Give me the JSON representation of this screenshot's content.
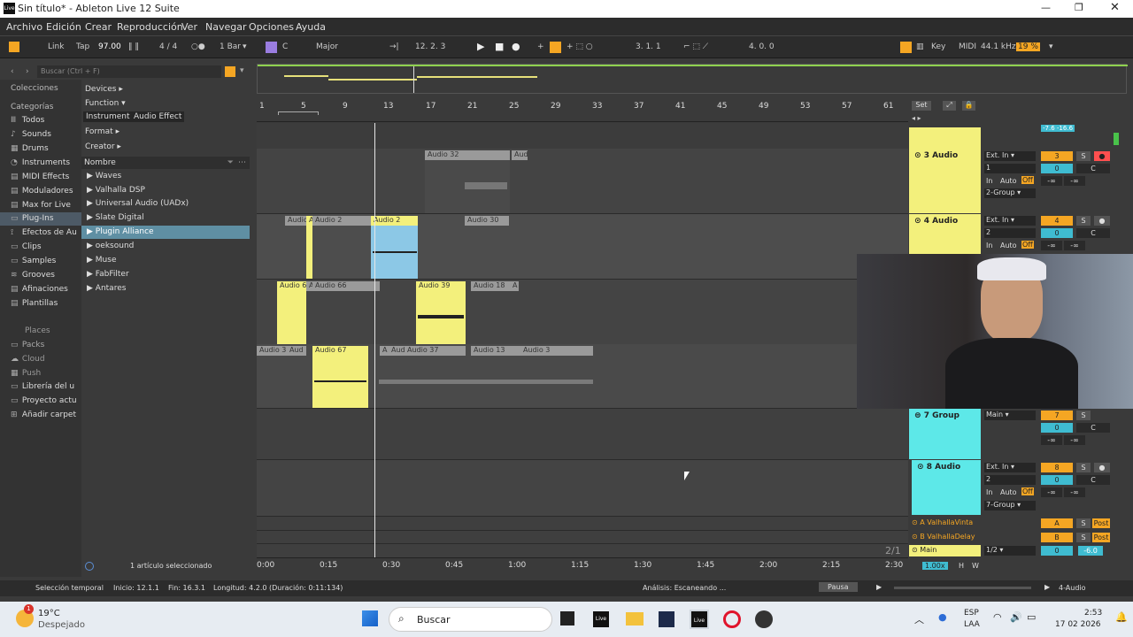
{
  "window": {
    "title": "Sin título* - Ableton Live 12 Suite"
  },
  "menu": [
    "Archivo",
    "Edición",
    "Crear",
    "Reproducción",
    "Ver",
    "Navegar",
    "Opciones",
    "Ayuda"
  ],
  "transport": {
    "link": "Link",
    "tap": "Tap",
    "tempo": "97.00",
    "signature": "4 / 4",
    "quantize": "1 Bar",
    "key_root": "C",
    "scale": "Major",
    "position": "12.  2.  3",
    "loop_start": "3.  1.  1",
    "loop_length": "4.  0.  0",
    "key_btn": "Key",
    "midi_btn": "MIDI",
    "sample_rate": "44.1 kHz",
    "cpu": "19 %"
  },
  "browser": {
    "search_placeholder": "Buscar (Ctrl + F)",
    "collections_label": "Colecciones",
    "categories_label": "Categorías",
    "categories": [
      "Todos",
      "Sounds",
      "Drums",
      "Instruments",
      "MIDI Effects",
      "Moduladores",
      "Max for Live",
      "Plug-Ins",
      "Efectos de Au",
      "Clips",
      "Samples",
      "Grooves",
      "Afinaciones",
      "Plantillas"
    ],
    "places_label": "Places",
    "places": [
      "Packs",
      "Cloud",
      "Push",
      "Librería del u",
      "Proyecto actu",
      "Añadir carpet"
    ],
    "filters": {
      "devices": "Devices ▸",
      "function": "Function ▾",
      "instrument": "Instrument",
      "audio_effect": "Audio Effect",
      "format": "Format ▸",
      "creator": "Creator ▸"
    },
    "list_header": "Nombre",
    "items": [
      "Waves",
      "Valhalla DSP",
      "Universal Audio (UADx)",
      "Slate Digital",
      "Plugin Alliance",
      "oeksound",
      "Muse",
      "FabFilter",
      "Antares"
    ],
    "selected_info": "1 artículo seleccionado"
  },
  "ruler": {
    "bars": [
      "1",
      "5",
      "9",
      "13",
      "17",
      "21",
      "25",
      "29",
      "33",
      "37",
      "41",
      "45",
      "49",
      "53",
      "57",
      "61"
    ],
    "set_btn": "Set",
    "times": [
      "0:00",
      "0:15",
      "0:30",
      "0:45",
      "1:00",
      "1:15",
      "1:30",
      "1:45",
      "2:00",
      "2:15",
      "2:30"
    ]
  },
  "clips": {
    "t3": [
      "Audio 32",
      "Aud"
    ],
    "t4": [
      "Audio",
      "A",
      "Audio 2",
      "Audio 2",
      "Audio 30"
    ],
    "t5": [
      "Audio 6",
      "A",
      "Audio 66",
      "Audio 39",
      "Audio 18",
      "A"
    ],
    "t6": [
      "Audio 3",
      "Aud",
      "Audio 67",
      "A",
      "Aud",
      "Audio 37",
      "Audio 13",
      "Audio 3"
    ]
  },
  "tracks": [
    {
      "name": "3 Audio",
      "input": "Ext. In",
      "ch": "1",
      "route": "2-Group",
      "num": "3",
      "vol": "0",
      "pan": "C"
    },
    {
      "name": "4 Audio",
      "input": "Ext. In",
      "ch": "2",
      "num": "4",
      "vol": "0",
      "pan": "C"
    },
    {
      "name": "7 Group",
      "input": "Main",
      "num": "7",
      "vol": "0",
      "pan": "C"
    },
    {
      "name": "8 Audio",
      "input": "Ext. In",
      "ch": "2",
      "route": "7-Group",
      "num": "8",
      "vol": "0",
      "pan": "C"
    }
  ],
  "returns": [
    {
      "name": "A ValhallaVinta",
      "letter": "A",
      "post": "Post"
    },
    {
      "name": "B ValhallaDelay",
      "letter": "B",
      "post": "Post"
    }
  ],
  "main": {
    "name": "Main",
    "ch": "1/2",
    "vol": "0",
    "gain": "-6.0",
    "page": "2/1"
  },
  "mix_labels": {
    "in": "In",
    "auto": "Auto",
    "off": "Off",
    "s": "S",
    "inf": "-∞",
    "gain_top": "-7.6",
    "gain_top2": "-16.6"
  },
  "zoom": {
    "ratio": "1.00x",
    "h": "H",
    "w": "W"
  },
  "status": {
    "selection": "Selección temporal",
    "start": "Inicio: 12.1.1",
    "end": "Fin: 16.3.1",
    "length": "Longitud: 4.2.0 (Duración: 0:11:134)",
    "analysis": "Análisis: Escaneando ...",
    "pause": "Pausa",
    "track": "4-Audio"
  },
  "taskbar": {
    "temp": "19°C",
    "weather": "Despejado",
    "search": "Buscar",
    "lang1": "ESP",
    "lang2": "LAA",
    "time": "2:53",
    "date": "17 02 2026",
    "badge": "1"
  },
  "colors": {
    "yellow": "#f3f07c",
    "cyan": "#5de8e8",
    "orange": "#f5a623",
    "blue_clip": "#8cc8e6"
  }
}
